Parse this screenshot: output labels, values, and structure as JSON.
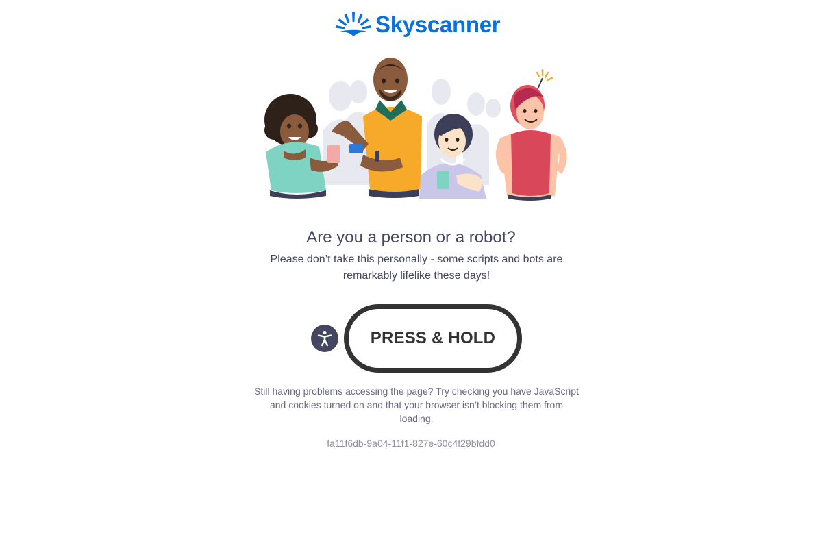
{
  "brand": {
    "name": "Skyscanner",
    "color": "#0770e3"
  },
  "heading": {
    "title": "Are you a person or a robot?",
    "subtitle": "Please don’t take this personally - some scripts and bots are remarkably lifelike these days!"
  },
  "challenge": {
    "accessibility_icon": "accessibility-icon",
    "button_label": "PRESS & HOLD"
  },
  "help": {
    "text": "Still having problems accessing the page? Try checking you have JavaScript and cookies turned on and that your browser isn’t blocking them from loading.",
    "reference_id": "fa11f6db-9a04-11f1-827e-60c4f29bfdd0"
  },
  "colors": {
    "text_dark": "#444560",
    "button_border": "#333333",
    "muted": "#68697f"
  }
}
